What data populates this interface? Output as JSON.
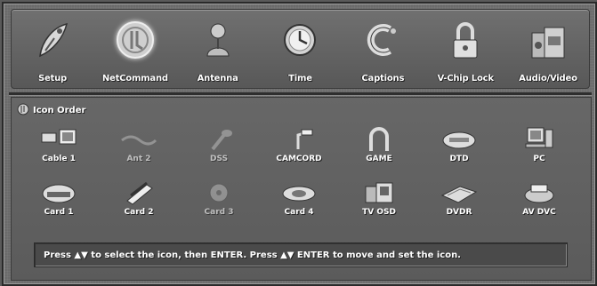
{
  "menu": {
    "items": [
      {
        "label": "Setup",
        "icon": "rocket-icon"
      },
      {
        "label": "NetCommand",
        "icon": "netcommand-icon",
        "active": true
      },
      {
        "label": "Antenna",
        "icon": "antenna-icon"
      },
      {
        "label": "Time",
        "icon": "clock-icon"
      },
      {
        "label": "Captions",
        "icon": "captions-icon"
      },
      {
        "label": "V-Chip Lock",
        "icon": "lock-icon"
      },
      {
        "label": "Audio/Video",
        "icon": "audio-video-icon"
      }
    ]
  },
  "panel": {
    "title": "Icon Order",
    "row1": [
      {
        "label": "Cable 1",
        "icon": "cable-icon",
        "dim": false
      },
      {
        "label": "Ant 2",
        "icon": "antenna-device-icon",
        "dim": true
      },
      {
        "label": "DSS",
        "icon": "dss-icon",
        "dim": true
      },
      {
        "label": "CAMCORD",
        "icon": "camcorder-icon",
        "dim": false
      },
      {
        "label": "GAME",
        "icon": "game-icon",
        "dim": false
      },
      {
        "label": "DTD",
        "icon": "dtd-icon",
        "dim": false
      },
      {
        "label": "PC",
        "icon": "pc-icon",
        "dim": false
      }
    ],
    "row2": [
      {
        "label": "Card 1",
        "icon": "card-icon",
        "dim": false
      },
      {
        "label": "Card 2",
        "icon": "card-icon",
        "dim": false
      },
      {
        "label": "Card 3",
        "icon": "card-icon",
        "dim": true
      },
      {
        "label": "Card 4",
        "icon": "card-icon",
        "dim": false
      },
      {
        "label": "TV OSD",
        "icon": "tv-osd-icon",
        "dim": false
      },
      {
        "label": "DVDR",
        "icon": "dvdr-icon",
        "dim": false
      },
      {
        "label": "AV DVC",
        "icon": "av-dvc-icon",
        "dim": false
      }
    ]
  },
  "help": {
    "text": "Press ▲▼ to select the icon, then ENTER.  Press ▲▼ ENTER to move and set the icon."
  }
}
